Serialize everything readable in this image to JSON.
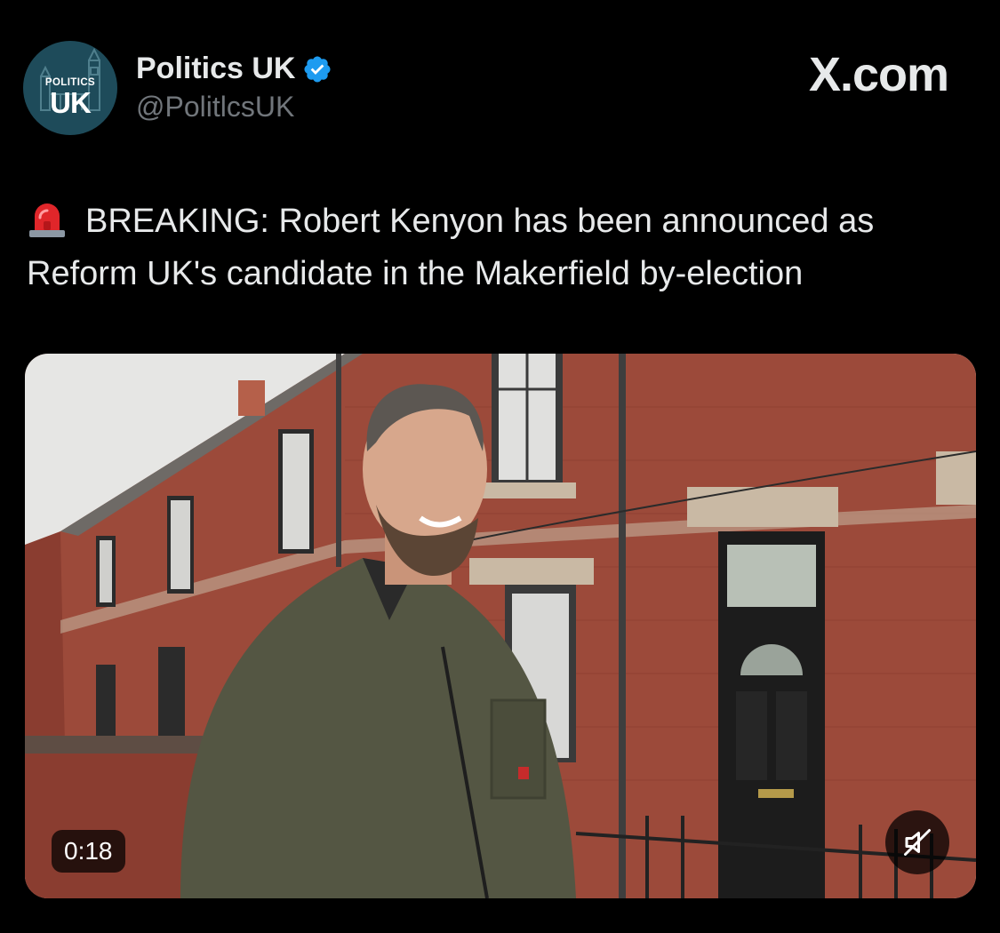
{
  "account": {
    "display_name": "Politics UK",
    "handle": "@PolitlcsUK",
    "avatar_small_text": "POLITICS",
    "avatar_big_text": "UK",
    "verified": true
  },
  "brand": {
    "label": "X.com"
  },
  "tweet": {
    "emoji_icon": "rotating-light-siren-icon",
    "text": "BREAKING: Robert Kenyon has been announced as Reform UK's candidate in the Makerfield by-election"
  },
  "media": {
    "type": "video",
    "duration": "0:18",
    "muted": true,
    "mute_icon": "speaker-muted-icon"
  },
  "colors": {
    "background": "#000000",
    "primary_text": "#e7e9ea",
    "secondary_text": "#71767b",
    "verified_badge": "#1d9bf0",
    "avatar_bg": "#1e4b5a"
  }
}
